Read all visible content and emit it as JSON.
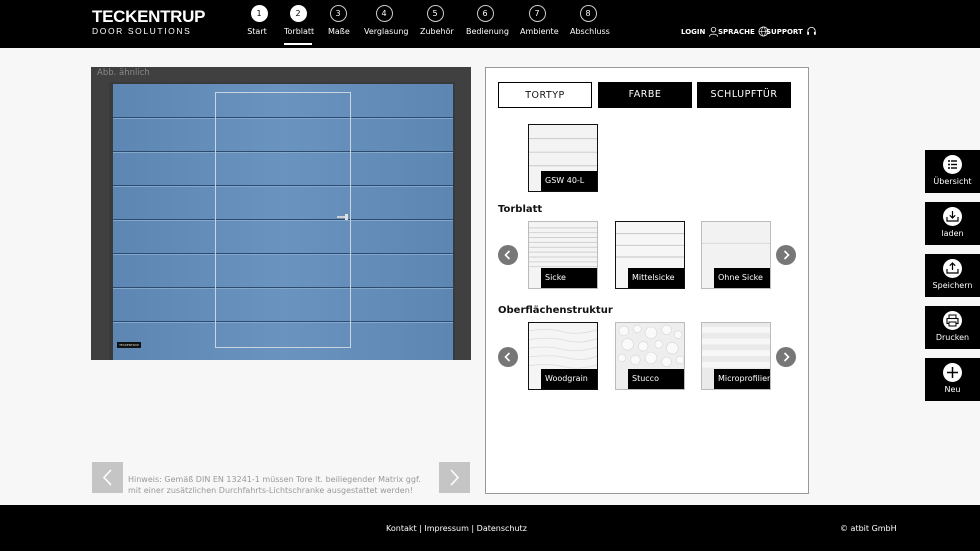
{
  "brand": {
    "name": "TECKENTRUP",
    "tagline": "DOOR SOLUTIONS"
  },
  "steps": [
    {
      "num": "1",
      "label": "Start",
      "state": "done"
    },
    {
      "num": "2",
      "label": "Torblatt",
      "state": "active"
    },
    {
      "num": "3",
      "label": "Maße",
      "state": "todo"
    },
    {
      "num": "4",
      "label": "Verglasung",
      "state": "todo"
    },
    {
      "num": "5",
      "label": "Zubehör",
      "state": "todo"
    },
    {
      "num": "6",
      "label": "Bedienung",
      "state": "todo"
    },
    {
      "num": "7",
      "label": "Ambiente",
      "state": "todo"
    },
    {
      "num": "8",
      "label": "Abschluss",
      "state": "todo"
    }
  ],
  "util_nav": {
    "login": "LOGIN",
    "language": "SPRACHE",
    "support": "SUPPORT"
  },
  "preview": {
    "note": "Abb. ähnlich",
    "hint": "Hinweis: Gemäß DIN EN 13241-1 müssen Tore lt. beiliegender Matrix ggf. mit einer zusätzlichen Durchfahrts-Lichtschranke ausgestattet werden!",
    "door_color": "#6a93bf",
    "door_logo": "TECKENTRUP"
  },
  "tabs": [
    {
      "label": "TORTYP",
      "style": "light"
    },
    {
      "label": "FARBE",
      "style": "dark"
    },
    {
      "label": "SCHLUPFTÜR",
      "style": "dark"
    }
  ],
  "selected_type": {
    "label": "GSW 40-L"
  },
  "torblatt": {
    "title": "Torblatt",
    "options": [
      {
        "label": "Sicke",
        "selected": false
      },
      {
        "label": "Mittelsicke",
        "selected": true
      },
      {
        "label": "Ohne Sicke",
        "selected": false
      }
    ]
  },
  "oberflaeche": {
    "title": "Oberflächenstruktur",
    "options": [
      {
        "label": "Woodgrain",
        "selected": true
      },
      {
        "label": "Stucco",
        "selected": false
      },
      {
        "label": "Microprofiliert",
        "selected": false
      }
    ]
  },
  "side_buttons": [
    {
      "label": "Übersicht",
      "icon": "list-icon"
    },
    {
      "label": "laden",
      "icon": "load-icon"
    },
    {
      "label": "Speichern",
      "icon": "save-icon"
    },
    {
      "label": "Drucken",
      "icon": "print-icon"
    },
    {
      "label": "Neu",
      "icon": "plus-icon"
    }
  ],
  "footer": {
    "kontakt": "Kontakt",
    "impressum": "Impressum",
    "datenschutz": "Datenschutz",
    "separator": " | ",
    "copyright": "© atbit GmbH"
  }
}
